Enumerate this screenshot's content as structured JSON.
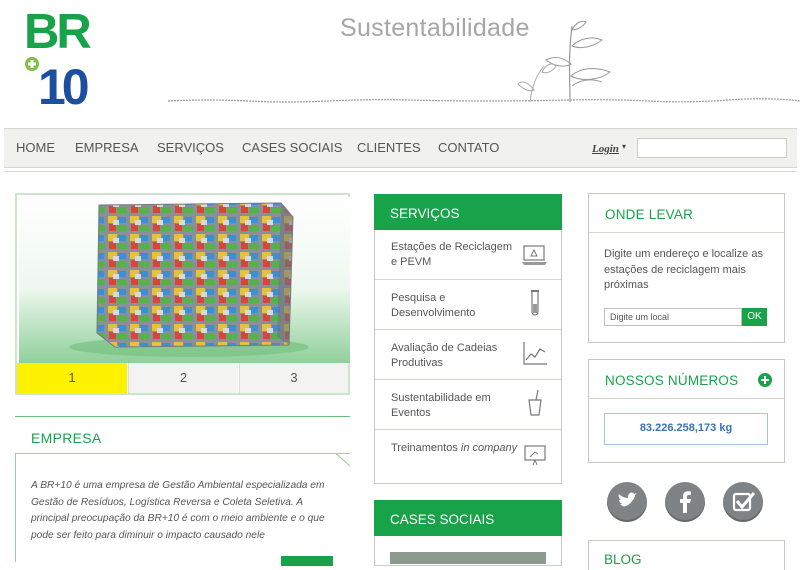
{
  "header": {
    "logo_top": "BR",
    "logo_bottom": "10",
    "logo_plus": "+",
    "tagline": "Sustentabilidade"
  },
  "nav": {
    "items": [
      "HOME",
      "EMPRESA",
      "SERVIÇOS",
      "CASES SOCIAIS",
      "CLIENTES",
      "CONTATO"
    ],
    "login_label": "Login",
    "login_caret": "▾",
    "search_value": ""
  },
  "slider": {
    "tabs": [
      "1",
      "2",
      "3"
    ],
    "active_tab": "1"
  },
  "empresa": {
    "title": "EMPRESA",
    "text": "A BR+10 é uma empresa de Gestão Ambiental especializada em Gestão de Resíduos, Logística Reversa e Coleta Seletiva. A principal preocupação da BR+10 é com o meio ambiente e o que pode ser feito para diminuir o impacto causado nele"
  },
  "services": {
    "title": "SERVIÇOS",
    "items": [
      {
        "label": "Estações de Reciclagem e PEVM",
        "icon": "recycling-station-icon"
      },
      {
        "label": "Pesquisa e Desenvolvimento",
        "icon": "test-tube-icon"
      },
      {
        "label": "Avaliação de Cadeias Produtivas",
        "icon": "line-chart-icon"
      },
      {
        "label": "Sustentabilidade em Eventos",
        "icon": "cup-icon"
      },
      {
        "label_main": "Treinamentos ",
        "label_em": "in company",
        "icon": "presentation-board-icon"
      }
    ]
  },
  "cases": {
    "title": "CASES SOCIAIS"
  },
  "onde_levar": {
    "title": "ONDE LEVAR",
    "text": "Digite um endereço e localize as estações de reciclagem mais próximas",
    "input_value": "Digite um local",
    "ok_label": "OK"
  },
  "numeros": {
    "title": "NOSSOS NÚMEROS",
    "value": "83.226.258,173 kg"
  },
  "social": {
    "icons": [
      "twitter-icon",
      "facebook-icon",
      "check-badge-icon"
    ]
  },
  "blog": {
    "title": "BLOG"
  },
  "colors": {
    "brand_green": "#18a24a",
    "brand_blue": "#1d4fa0",
    "active_yellow": "#fff200",
    "number_blue": "#3b72b8"
  }
}
